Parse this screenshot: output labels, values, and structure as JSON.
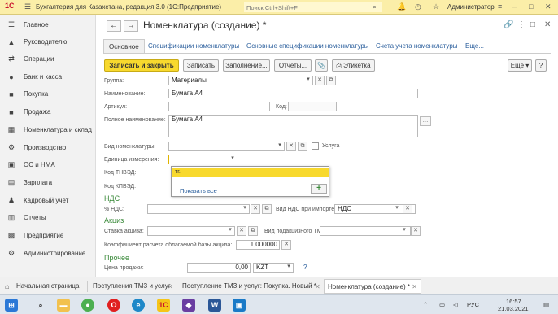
{
  "titlebar": {
    "logo": "1С",
    "title": "Бухгалтерия для Казахстана, редакция 3.0  (1С:Предприятие)",
    "search_placeholder": "Поиск Ctrl+Shift+F",
    "user": "Администратор"
  },
  "sidebar": {
    "items": [
      {
        "label": "Главное",
        "icon": "menu-icon"
      },
      {
        "label": "Руководителю",
        "icon": "chart-icon"
      },
      {
        "label": "Операции",
        "icon": "operations-icon"
      },
      {
        "label": "Банк и касса",
        "icon": "bank-icon"
      },
      {
        "label": "Покупка",
        "icon": "cart-icon"
      },
      {
        "label": "Продажа",
        "icon": "sale-icon"
      },
      {
        "label": "Номенклатура и склад",
        "icon": "warehouse-icon"
      },
      {
        "label": "Производство",
        "icon": "production-icon"
      },
      {
        "label": "ОС и НМА",
        "icon": "assets-icon"
      },
      {
        "label": "Зарплата",
        "icon": "salary-icon"
      },
      {
        "label": "Кадровый учет",
        "icon": "staff-icon"
      },
      {
        "label": "Отчеты",
        "icon": "reports-icon"
      },
      {
        "label": "Предприятие",
        "icon": "enterprise-icon"
      },
      {
        "label": "Администрирование",
        "icon": "admin-icon"
      }
    ]
  },
  "form": {
    "title": "Номенклатура (создание) *",
    "tabs": [
      "Основное",
      "Спецификации номенклатуры",
      "Основные спецификации номенклатуры",
      "Счета учета номенклатуры",
      "Еще..."
    ],
    "toolbar": {
      "save_close": "Записать и закрыть",
      "save": "Записать",
      "fill": "Заполнение...",
      "reports": "Отчеты...",
      "label": "Этикетка",
      "more": "Еще",
      "help": "?"
    },
    "fields": {
      "group_label": "Группа:",
      "group_value": "Материалы",
      "name_label": "Наименование:",
      "name_value": "Бумага А4",
      "article_label": "Артикул:",
      "article_value": "",
      "code_label": "Код:",
      "code_value": "",
      "fullname_label": "Полное наименование:",
      "fullname_value": "Бумага А4",
      "type_label": "Вид номенклатуры:",
      "type_value": "",
      "service_label": "Услуга",
      "unit_label": "Единица измерения:",
      "unit_value": "",
      "tnved_label": "Код ТНВЭД:",
      "kpved_label": "Код КПВЭД:"
    },
    "nds": {
      "section": "НДС",
      "rate_label": "% НДС:",
      "rate_value": "",
      "import_label": "Вид НДС при импорте:",
      "import_value": "НДС"
    },
    "excise": {
      "section": "Акциз",
      "rate_label": "Ставка акциза:",
      "rate_value": "",
      "tmz_label": "Вид подакцизного ТМЗ:",
      "tmz_value": "",
      "coef_label": "Коэффициент расчета облагаемой базы акциза:",
      "coef_value": "1,000000"
    },
    "other": {
      "section": "Прочее",
      "price_label": "Цена продажи:",
      "price_value": "0,00",
      "currency": "KZT"
    },
    "dropdown": {
      "option": "тг.",
      "show_all": "Показать все",
      "add": "+"
    }
  },
  "window_tabs": [
    {
      "label": "Начальная страница"
    },
    {
      "label": "Поступления ТМЗ и услуг"
    },
    {
      "label": "Поступление ТМЗ и услуг: Покупка. Новый *"
    },
    {
      "label": "Номенклатура (создание) *"
    }
  ],
  "taskbar": {
    "lang": "РУС",
    "time": "16:57",
    "date": "21.03.2021"
  }
}
